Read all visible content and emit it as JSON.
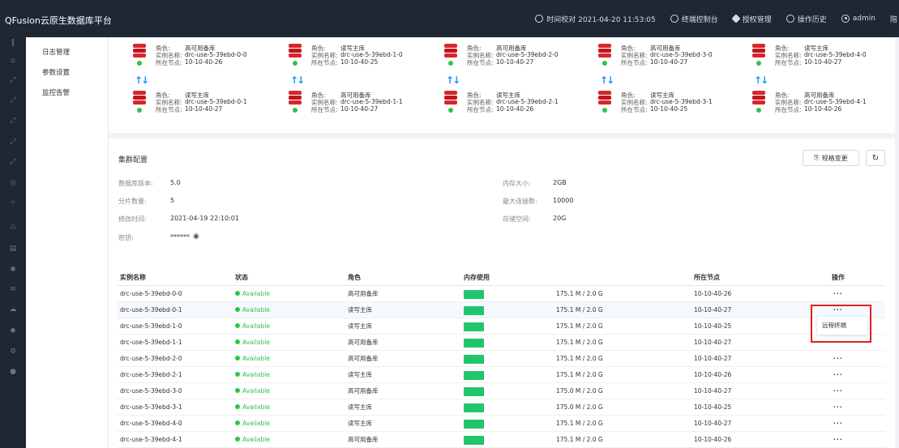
{
  "app": {
    "title": "QFusion云原生数据库平台"
  },
  "topnav": [
    {
      "label": "时间校对 2021-04-20 11:53:05",
      "icon": "clock-icon"
    },
    {
      "label": "终端控制台",
      "icon": "terminal-icon"
    },
    {
      "label": "授权管理",
      "icon": "license-icon"
    },
    {
      "label": "操作历史",
      "icon": "history-icon"
    },
    {
      "label": "admin",
      "icon": "user-icon"
    },
    {
      "label": "陪",
      "icon": ""
    }
  ],
  "submenu": [
    "日志管理",
    "参数设置",
    "监控告警"
  ],
  "topology": {
    "labels": {
      "role": "角色:",
      "instance": "实例名称:",
      "node": "所在节点:"
    },
    "pairs": [
      {
        "a": {
          "role": "高可用备库",
          "instance": "drc-use-5-39ebd-0-0",
          "node": "10-10-40-26"
        },
        "b": {
          "role": "读写主库",
          "instance": "drc-use-5-39ebd-0-1",
          "node": "10-10-40-27"
        }
      },
      {
        "a": {
          "role": "读写主库",
          "instance": "drc-use-5-39ebd-1-0",
          "node": "10-10-40-25"
        },
        "b": {
          "role": "高可用备库",
          "instance": "drc-use-5-39ebd-1-1",
          "node": "10-10-40-27"
        }
      },
      {
        "a": {
          "role": "高可用备库",
          "instance": "drc-use-5-39ebd-2-0",
          "node": "10-10-40-27"
        },
        "b": {
          "role": "读写主库",
          "instance": "drc-use-5-39ebd-2-1",
          "node": "10-10-40-26"
        }
      },
      {
        "a": {
          "role": "高可用备库",
          "instance": "drc-use-5-39ebd-3-0",
          "node": "10-10-40-27"
        },
        "b": {
          "role": "读写主库",
          "instance": "drc-use-5-39ebd-3-1",
          "node": "10-10-40-25"
        }
      },
      {
        "a": {
          "role": "读写主库",
          "instance": "drc-use-5-39ebd-4-0",
          "node": "10-10-40-27"
        },
        "b": {
          "role": "高可用备库",
          "instance": "drc-use-5-39ebd-4-1",
          "node": "10-10-40-26"
        }
      }
    ]
  },
  "config": {
    "title": "集群配置",
    "spec_button": "规格变更",
    "left": [
      {
        "k": "数据库版本:",
        "v": "5.0"
      },
      {
        "k": "分片数量:",
        "v": "5"
      },
      {
        "k": "修改时间:",
        "v": "2021-04-19 22:10:01"
      },
      {
        "k": "密钥:",
        "v": "****** "
      }
    ],
    "right": [
      {
        "k": "内存大小:",
        "v": "2GB"
      },
      {
        "k": "最大连接数:",
        "v": "10000"
      },
      {
        "k": "存储空间:",
        "v": "20G"
      }
    ]
  },
  "table": {
    "headers": [
      "实例名称",
      "状态",
      "角色",
      "内存使用",
      "所在节点",
      "操作"
    ],
    "rows": [
      {
        "name": "drc-use-5-39ebd-0-0",
        "status": "Available",
        "role": "高可用备库",
        "mem": "175.1 M / 2.0 G",
        "node": "10-10-40-26",
        "op": "···"
      },
      {
        "name": "drc-use-5-39ebd-0-1",
        "status": "Available",
        "role": "读写主库",
        "mem": "175.1 M / 2.0 G",
        "node": "10-10-40-27",
        "op": "···"
      },
      {
        "name": "drc-use-5-39ebd-1-0",
        "status": "Available",
        "role": "读写主库",
        "mem": "175.1 M / 2.0 G",
        "node": "10-10-40-25",
        "op": "···"
      },
      {
        "name": "drc-use-5-39ebd-1-1",
        "status": "Available",
        "role": "高可用备库",
        "mem": "175.1 M / 2.0 G",
        "node": "10-10-40-27",
        "op": "···"
      },
      {
        "name": "drc-use-5-39ebd-2-0",
        "status": "Available",
        "role": "高可用备库",
        "mem": "175.1 M / 2.0 G",
        "node": "10-10-40-27",
        "op": "···"
      },
      {
        "name": "drc-use-5-39ebd-2-1",
        "status": "Available",
        "role": "读写主库",
        "mem": "175.1 M / 2.0 G",
        "node": "10-10-40-26",
        "op": "···"
      },
      {
        "name": "drc-use-5-39ebd-3-0",
        "status": "Available",
        "role": "高可用备库",
        "mem": "175.0 M / 2.0 G",
        "node": "10-10-40-27",
        "op": "···"
      },
      {
        "name": "drc-use-5-39ebd-3-1",
        "status": "Available",
        "role": "读写主库",
        "mem": "175.0 M / 2.0 G",
        "node": "10-10-40-25",
        "op": "···"
      },
      {
        "name": "drc-use-5-39ebd-4-0",
        "status": "Available",
        "role": "读写主库",
        "mem": "175.1 M / 2.0 G",
        "node": "10-10-40-27",
        "op": "···"
      },
      {
        "name": "drc-use-5-39ebd-4-1",
        "status": "Available",
        "role": "高可用备库",
        "mem": "175.1 M / 2.0 G",
        "node": "10-10-40-26",
        "op": "···"
      }
    ]
  },
  "dropdown": {
    "item": "远程终端"
  },
  "colors": {
    "topbar": "#1f2634",
    "status_green": "#33c24a",
    "bar_green": "#22c56e",
    "db_red": "#d9262c",
    "highlight_red": "#e02020"
  }
}
